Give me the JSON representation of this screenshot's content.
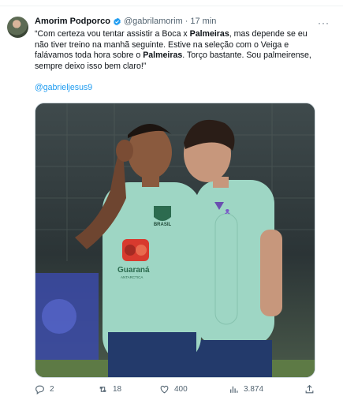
{
  "author": {
    "name": "Amorim Podporco",
    "handle": "@gabrilamorim",
    "separator": "·",
    "time": "17 min"
  },
  "tweet": {
    "text_parts": [
      "“Com certeza vou tentar assistir a Boca x ",
      "Palmeiras",
      ", mas depende se eu não tiver treino na manhã seguinte. Estive na seleção com o Veiga e falávamos toda hora sobre o ",
      "Palmeiras",
      ". Torço bastante. Sou palmeirense, sempre deixo isso bem claro!”"
    ],
    "mention": "@gabrieljesus9"
  },
  "image": {
    "shirt_brand": "Guaraná",
    "shirt_brand_sub": "ANTARCTICA",
    "crest_label": "BRASIL",
    "colors": {
      "shirt": "#9ed6c4",
      "shorts": "#233a6b",
      "background": "#2f3a3f",
      "accent": "#d83a2e"
    }
  },
  "actions": {
    "replies": "2",
    "reposts": "18",
    "likes": "400",
    "views": "3.874"
  },
  "colors": {
    "accent": "#1d9bf0",
    "muted": "#536471",
    "text": "#0f1419",
    "border": "#cfd9de"
  },
  "icons": [
    "verified-badge-icon",
    "more-icon",
    "reply-icon",
    "repost-icon",
    "like-icon",
    "views-icon",
    "share-icon"
  ]
}
